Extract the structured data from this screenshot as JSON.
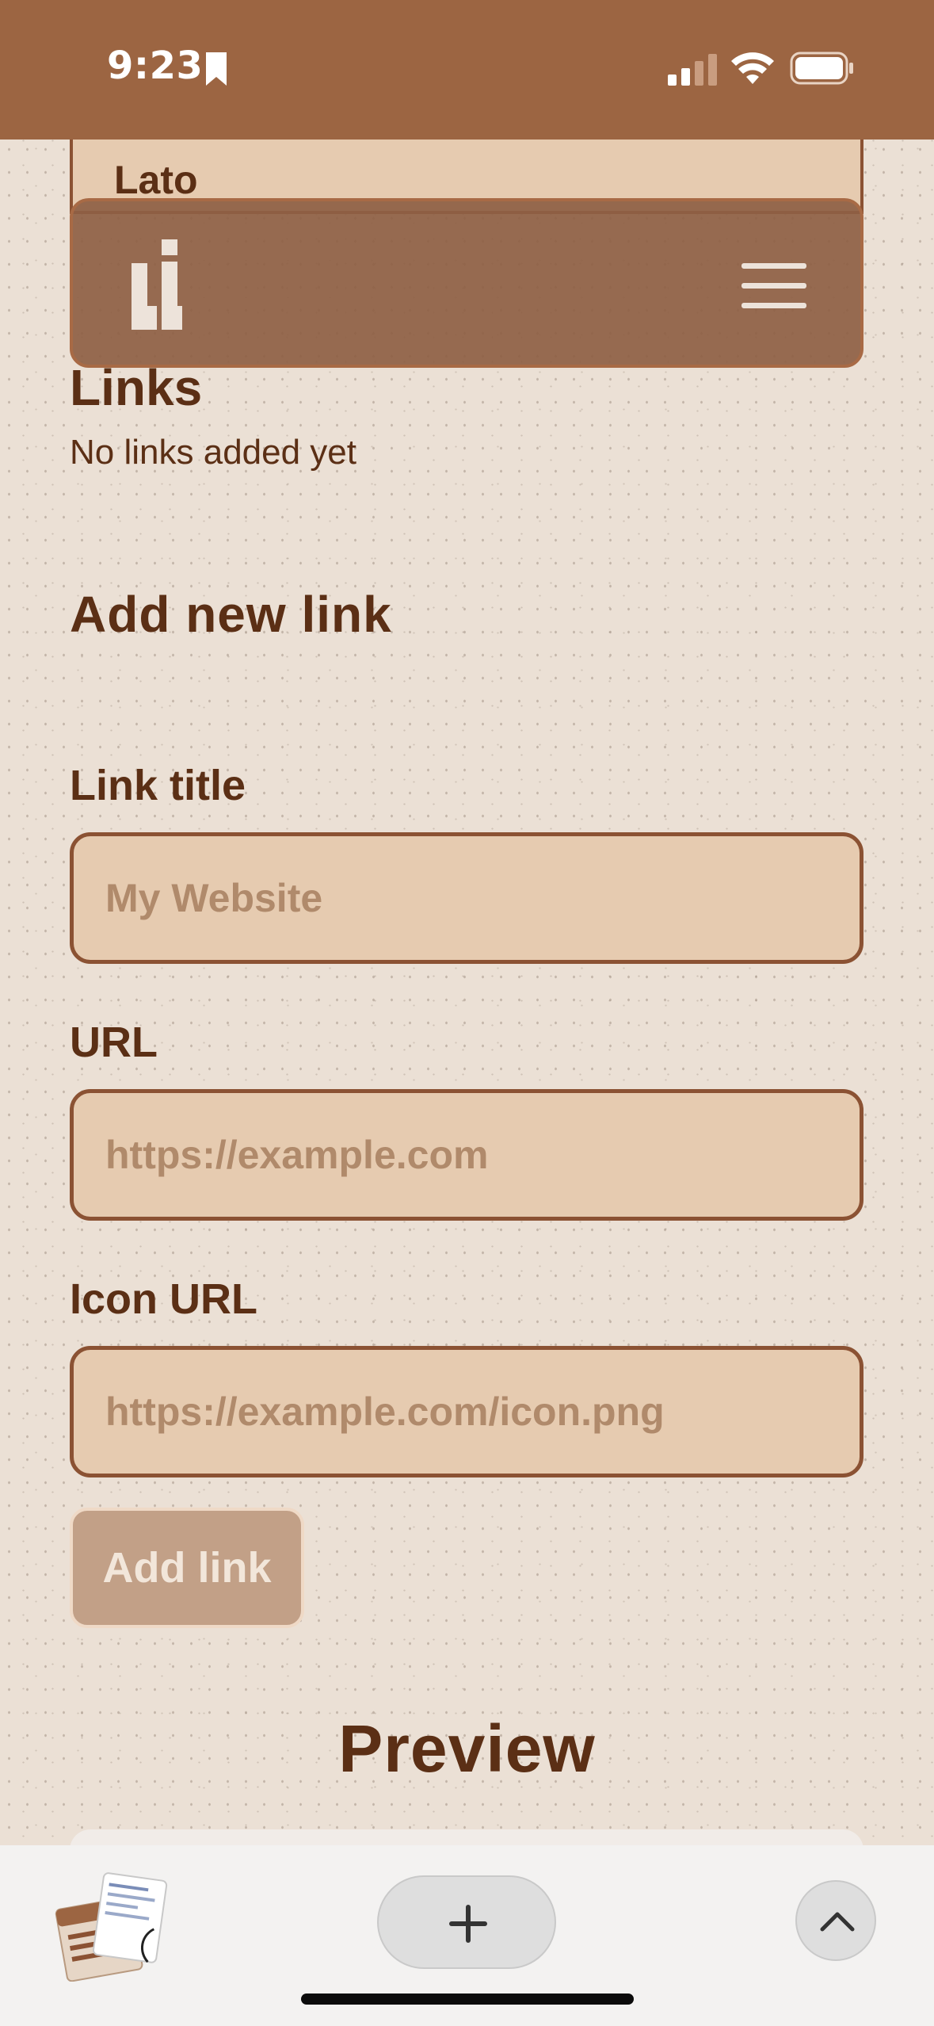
{
  "status_bar": {
    "time": "9:23",
    "icons": [
      "bookmark-icon",
      "signal-icon",
      "wifi-icon",
      "battery-icon"
    ]
  },
  "font_select": {
    "value": "Lato"
  },
  "header": {
    "logo": "li-logo-icon",
    "menu": "hamburger-menu-icon"
  },
  "links": {
    "title": "Links",
    "empty_text": "No links added yet"
  },
  "form": {
    "title": "Add new link",
    "link_title_label": "Link title",
    "link_title_placeholder": "My Website",
    "url_label": "URL",
    "url_placeholder": "https://example.com",
    "icon_url_label": "Icon URL",
    "icon_url_placeholder": "https://example.com/icon.png",
    "add_button": "Add link"
  },
  "preview": {
    "title": "Preview"
  },
  "bottom_bar": {
    "icons": [
      "tabs-thumbnail",
      "plus-icon",
      "chevron-up-icon"
    ]
  },
  "colors": {
    "brand_brown": "#9c6542",
    "text_dark": "#5b2f15",
    "input_bg": "#e6cbb0",
    "input_border": "#8b5233",
    "page_bg": "#ebe0d5"
  }
}
